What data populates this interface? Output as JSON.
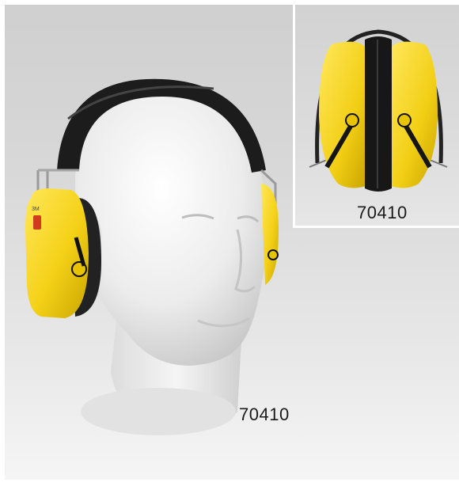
{
  "product_image": {
    "main_caption": "70410",
    "inset_caption": "70410",
    "brand_mark": "3M",
    "colors": {
      "earcup_yellow": "#f2d21a",
      "headband_black": "#1c1c1c",
      "mannequin_white": "#f1f1f1",
      "background_gray": "#d4d4d4"
    }
  }
}
